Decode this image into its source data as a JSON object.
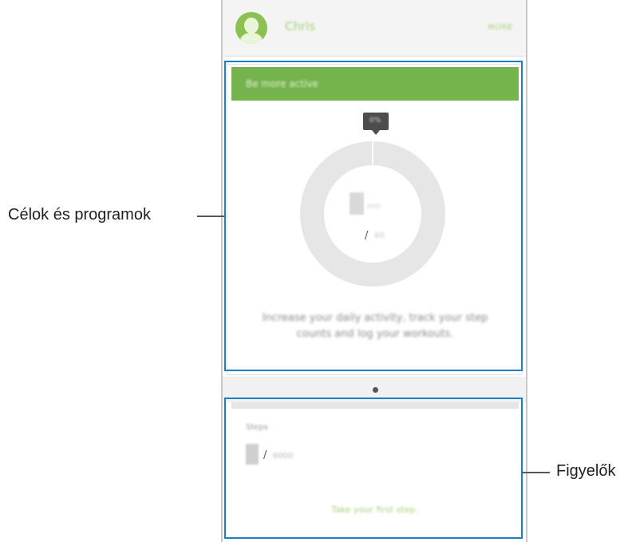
{
  "header": {
    "username": "Chris",
    "more_label": "MORE"
  },
  "goal_card": {
    "title": "Be more active",
    "percent": "0%",
    "current_value": "0",
    "current_unit": "min",
    "target": "60",
    "description": "Increase your daily activity, track your step counts and log your workouts."
  },
  "tracker_card": {
    "title": "Steps",
    "current_value": "0",
    "target": "6000",
    "link_label": "Take your first step."
  },
  "pager": {
    "page": 1
  },
  "callouts": {
    "goals": "Célok és programok",
    "trackers": "Figyelők"
  },
  "colors": {
    "accent_green": "#75b34d",
    "highlight_blue": "#1c7fc3"
  }
}
